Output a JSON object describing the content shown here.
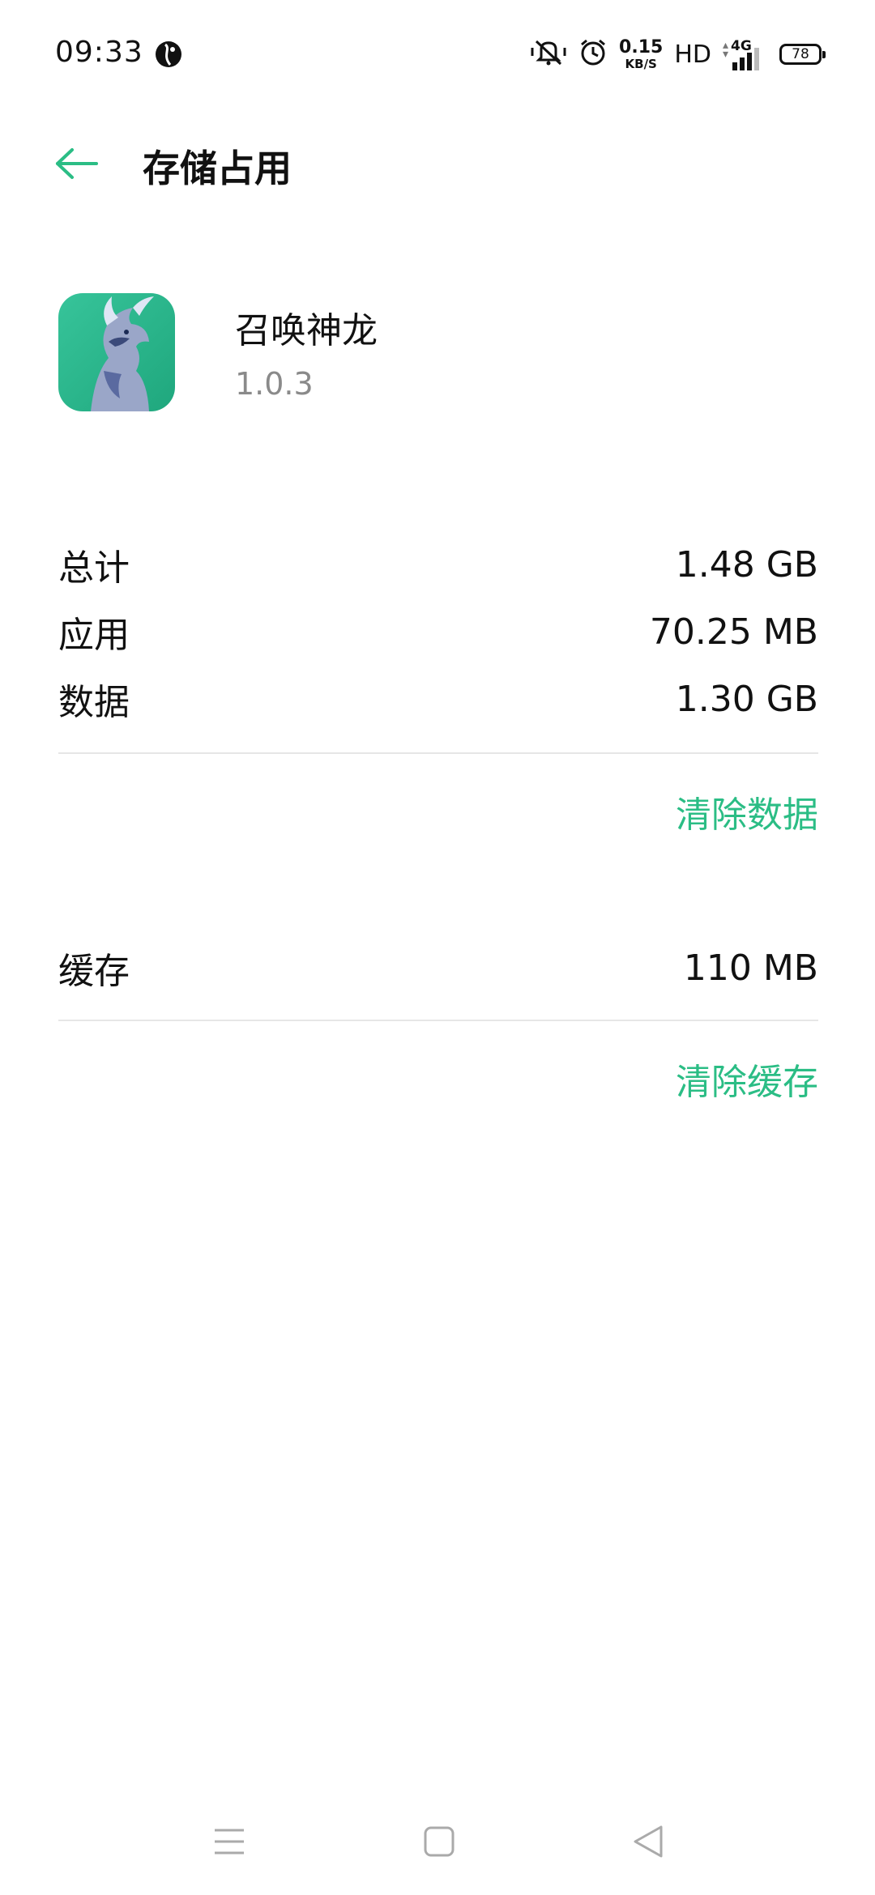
{
  "status_bar": {
    "time": "09:33",
    "speed_value": "0.15",
    "speed_unit": "KB/S",
    "hd": "HD",
    "network": "4G",
    "battery": "78",
    "icons": [
      "location-icon",
      "mute-icon",
      "alarm-icon",
      "signal-icon",
      "battery-icon"
    ]
  },
  "header": {
    "title": "存储占用",
    "back_icon": "back-arrow-icon"
  },
  "app": {
    "name": "召唤神龙",
    "version": "1.0.3",
    "icon": "dragon-app-icon"
  },
  "storage": {
    "rows": [
      {
        "label": "总计",
        "value": "1.48 GB"
      },
      {
        "label": "应用",
        "value": "70.25 MB"
      },
      {
        "label": "数据",
        "value": "1.30 GB"
      }
    ],
    "clear_data_label": "清除数据"
  },
  "cache": {
    "label": "缓存",
    "value": "110 MB",
    "clear_cache_label": "清除缓存"
  },
  "nav_bar": {
    "icons": [
      "menu-icon",
      "home-icon",
      "back-triangle-icon"
    ]
  },
  "colors": {
    "accent": "#2bbd85",
    "text": "#111111",
    "secondary_text": "#8a8a8a",
    "divider": "#e6e6e6"
  }
}
